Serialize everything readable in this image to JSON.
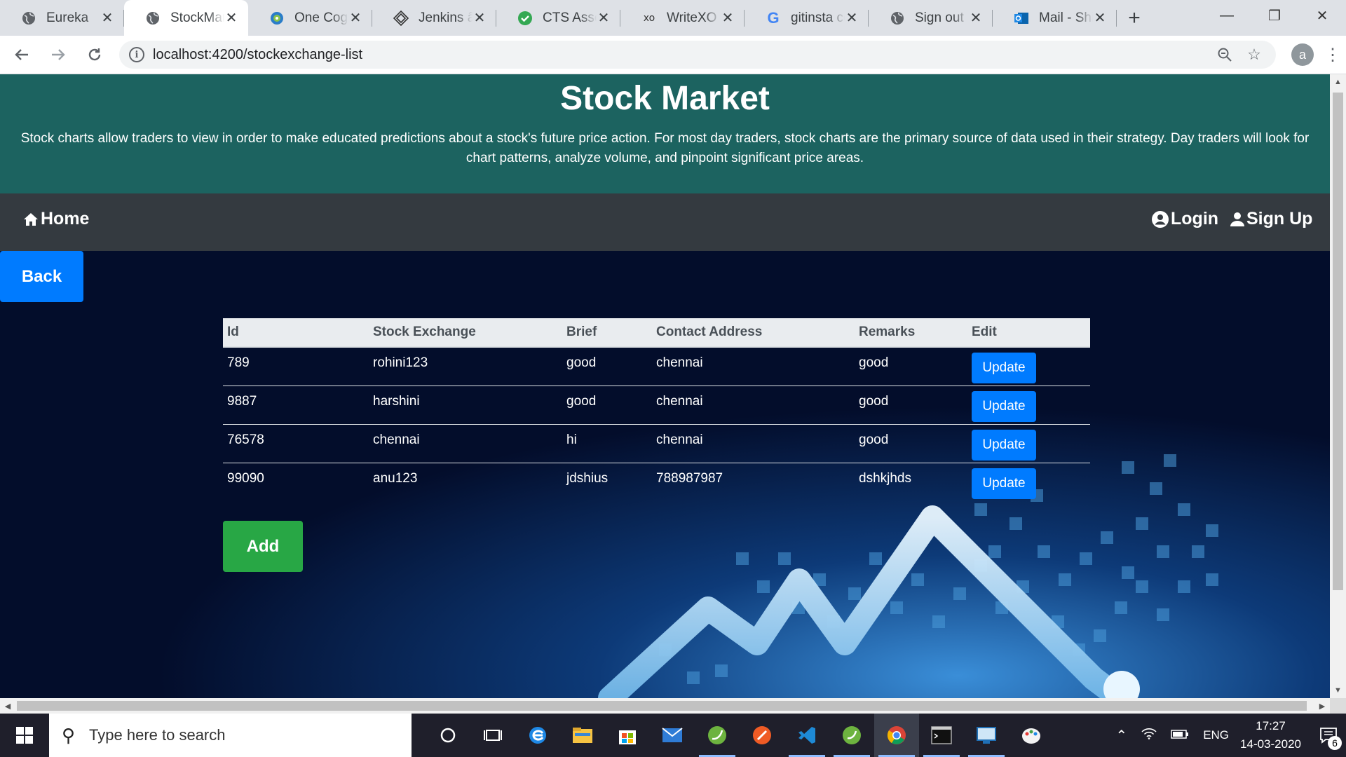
{
  "browser": {
    "tabs": [
      {
        "title": "Eureka",
        "icon": "globe-icon"
      },
      {
        "title": "StockMarket",
        "icon": "globe-icon",
        "active": true
      },
      {
        "title": "One Cognizant",
        "icon": "cognizant-icon"
      },
      {
        "title": "Jenkins âŒ",
        "icon": "jenkins-icon"
      },
      {
        "title": "CTS Assessment",
        "icon": "check-icon"
      },
      {
        "title": "WriteXO",
        "icon": "xo-icon"
      },
      {
        "title": "gitinsta cc",
        "icon": "google-icon"
      },
      {
        "title": "Sign out",
        "icon": "globe-icon"
      },
      {
        "title": "Mail - Shi",
        "icon": "outlook-icon"
      }
    ],
    "url": "localhost:4200/stockexchange-list",
    "profile_initial": "a"
  },
  "page": {
    "title": "Stock Market",
    "description": "Stock charts allow traders to view in order to make educated predictions about a stock's future price action. For most day traders, stock charts are the primary source of data used in their strategy. Day traders will look for chart patterns, analyze volume, and pinpoint significant price areas.",
    "nav": {
      "home": "Home",
      "login": "Login",
      "signup": "Sign Up"
    },
    "back_label": "Back",
    "add_label": "Add",
    "table": {
      "headers": [
        "Id",
        "Stock Exchange",
        "Brief",
        "Contact Address",
        "Remarks",
        "Edit"
      ],
      "update_label": "Update",
      "rows": [
        [
          "789",
          "rohini123",
          "good",
          "chennai",
          "good"
        ],
        [
          "9887",
          "harshini",
          "good",
          "chennai",
          "good"
        ],
        [
          "76578",
          "chennai",
          "hi",
          "chennai",
          "good"
        ],
        [
          "99090",
          "anu123",
          "jdshius",
          "788987987",
          "dshkjhds"
        ]
      ]
    }
  },
  "taskbar": {
    "search_placeholder": "Type here to search",
    "language": "ENG",
    "time": "17:27",
    "date": "14-03-2020",
    "notification_count": "6"
  }
}
